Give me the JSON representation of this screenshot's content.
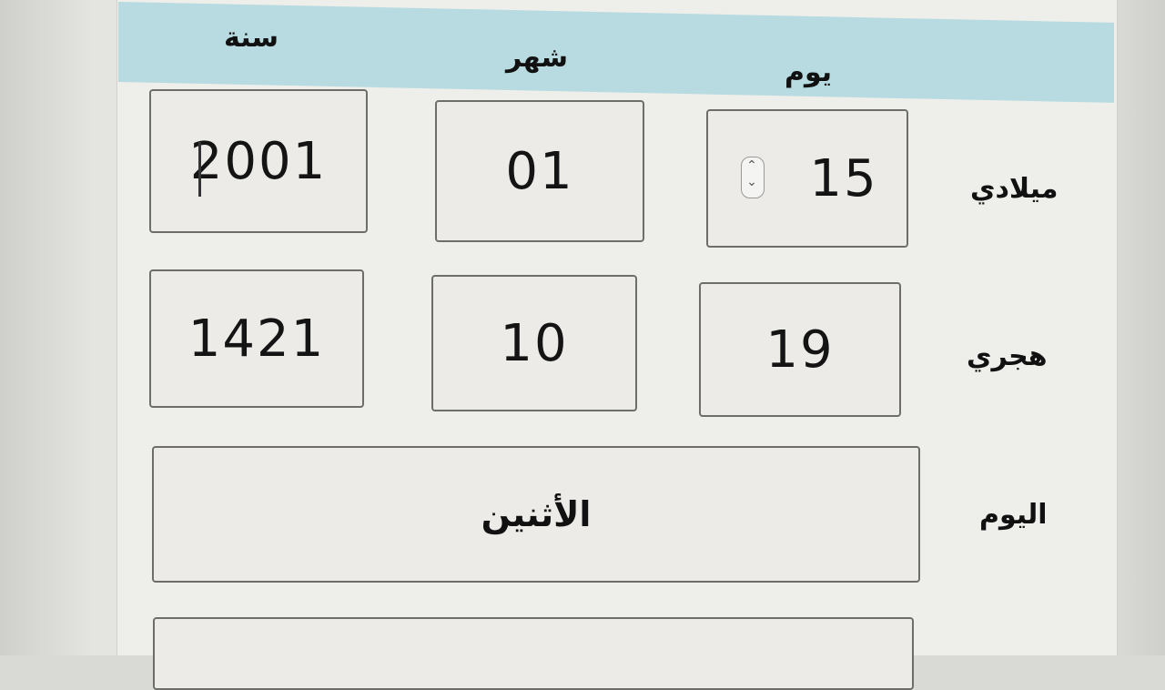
{
  "header": {
    "columns": {
      "year": "سنة",
      "month": "شهر",
      "day": "يوم"
    }
  },
  "rows": {
    "gregorian": {
      "label": "ميلادي",
      "year": "2001",
      "month": "01",
      "day": "15"
    },
    "hijri": {
      "label": "هجري",
      "year": "1421",
      "month": "10",
      "day": "19"
    },
    "weekday": {
      "label": "اليوم",
      "value": "الأثنين"
    }
  },
  "icons": {
    "stepper": "spin-stepper-icon"
  }
}
